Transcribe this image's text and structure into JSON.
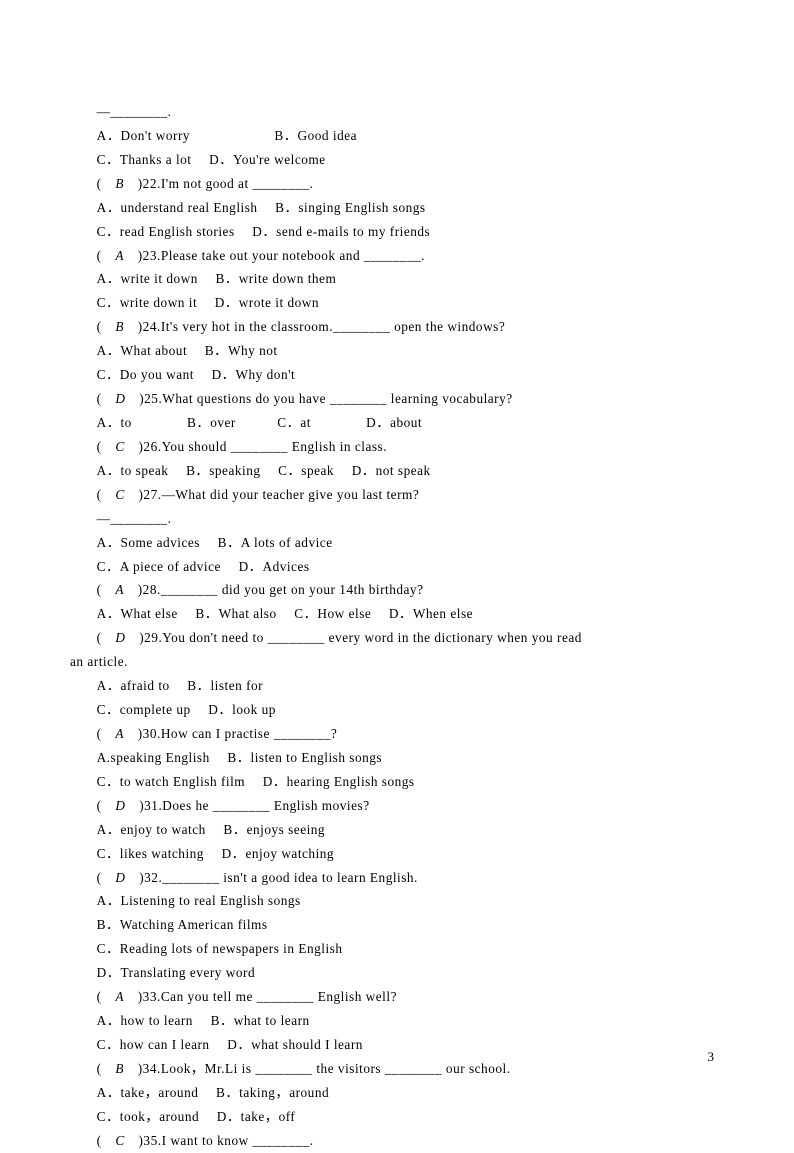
{
  "page_number": "3",
  "q21": {
    "dash": "—________.",
    "optA": "A．Don't worry",
    "optB": "B．Good idea",
    "optC": "C．Thanks a lot",
    "optD": "D．You're welcome"
  },
  "q22": {
    "ans": "B",
    "num": ")22.",
    "stem": "I'm not good at ________.",
    "optA": "A．understand real English",
    "optB": "B．singing English songs",
    "optC": "C．read English stories",
    "optD": "D．send e-mails to my friends"
  },
  "q23": {
    "ans": "A",
    "num": ")23.",
    "stem": "Please take out your notebook and ________.",
    "optA": "A．write it down",
    "optB": "B．write down them",
    "optC": "C．write down it",
    "optD": "D．wrote it down"
  },
  "q24": {
    "ans": "B",
    "num": ")24.",
    "stem": "It's very hot in the classroom.________ open the windows?",
    "optA": "A．What about",
    "optB": "B．Why not",
    "optC": "C．Do you want",
    "optD": "D．Why don't"
  },
  "q25": {
    "ans": "D",
    "num": ")25.",
    "stem": "What questions do you have ________ learning vocabulary?",
    "optA": "A．to",
    "optB": "B．over",
    "optC": "C．at",
    "optD": "D．about"
  },
  "q26": {
    "ans": "C",
    "num": ")26.",
    "stem": "You should ________ English in class.",
    "optA": "A．to speak",
    "optB": "B．speaking",
    "optC": "C．speak",
    "optD": "D．not speak"
  },
  "q27": {
    "ans": "C",
    "num": ")27.",
    "stem": "—What did your teacher give you last term?",
    "dash": "—________.",
    "optA": "A．Some advices",
    "optB": "B．A lots of advice",
    "optC": "C．A piece of advice",
    "optD": "D．Advices"
  },
  "q28": {
    "ans": "A",
    "num": ")28.",
    "stem": "________ did you get on your 14th birthday?",
    "optA": "A．What else",
    "optB": "B．What also",
    "optC": "C．How else",
    "optD": "D．When else"
  },
  "q29": {
    "ans": "D",
    "num": ")29.",
    "stem_part1": "You don't need to ________ every word in the dictionary when you read",
    "stem_part2": "an article.",
    "optA": "A．afraid to",
    "optB": "B．listen for",
    "optC": "C．complete up",
    "optD": "D．look up"
  },
  "q30": {
    "ans": "A",
    "num": ")30.",
    "stem": "How can I practise ________?",
    "optA": "A.speaking English",
    "optB": "B．listen to English songs",
    "optC": "C．to watch English film",
    "optD": "D．hearing English songs"
  },
  "q31": {
    "ans": "D",
    "num": ")31.",
    "stem": "Does he ________ English movies?",
    "optA": "A．enjoy to watch",
    "optB": "B．enjoys seeing",
    "optC": "C．likes watching",
    "optD": "D．enjoy watching"
  },
  "q32": {
    "ans": "D",
    "num": ")32.",
    "stem": "________ isn't a good idea to learn English.",
    "optA": "A．Listening to real English songs",
    "optB": "B．Watching American films",
    "optC": "C．Reading lots of newspapers in English",
    "optD": "D．Translating every word"
  },
  "q33": {
    "ans": "A",
    "num": ")33.",
    "stem": "Can you tell me ________ English well?",
    "optA": "A．how to learn",
    "optB": "B．what to learn",
    "optC": "C．how can I learn",
    "optD": "D．what should I learn"
  },
  "q34": {
    "ans": "B",
    "num": ")34.",
    "stem": "Look，Mr.Li is ________ the visitors ________ our school.",
    "optA": "A．take，around",
    "optB": "B．taking，around",
    "optC": "C．took，around",
    "optD": "D．take，off"
  },
  "q35": {
    "ans": "C",
    "num": ")35.",
    "stem": "I want to know ________."
  }
}
